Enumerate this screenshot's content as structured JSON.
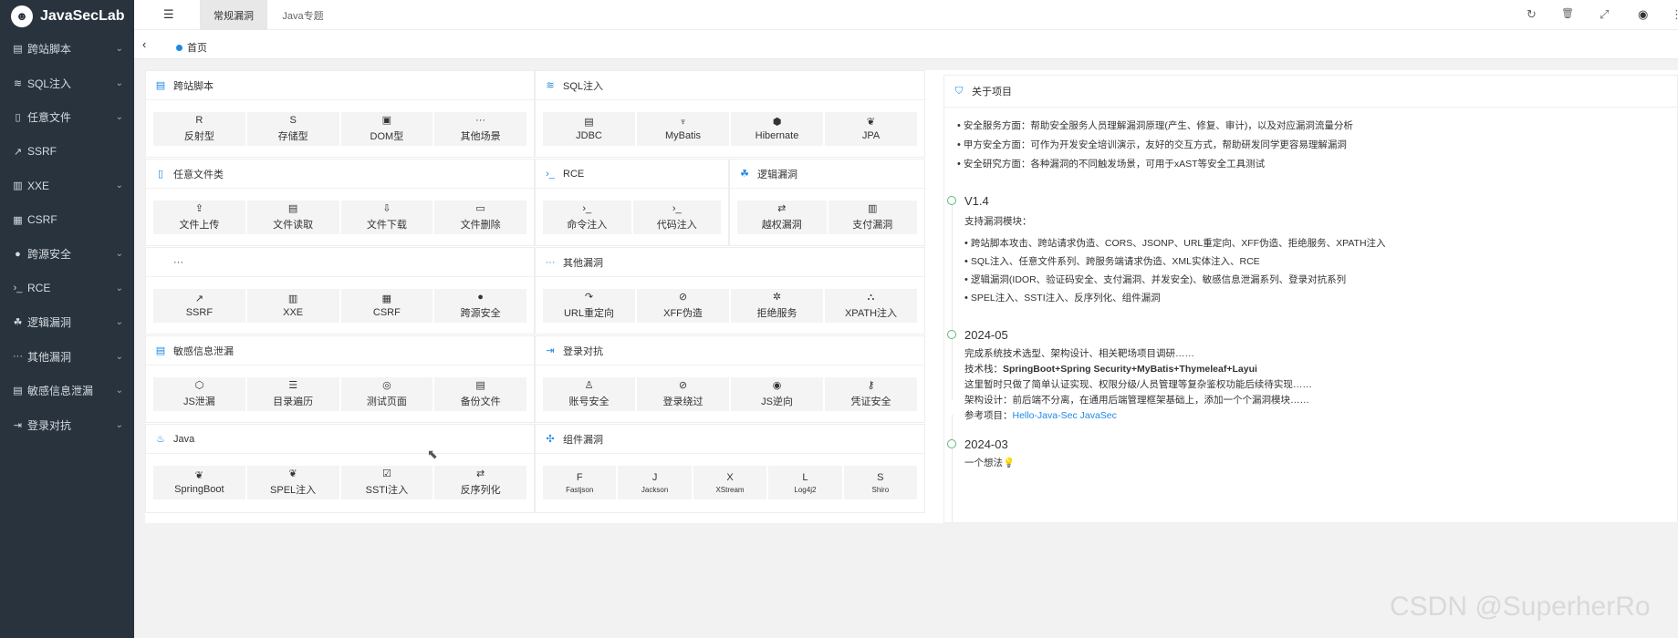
{
  "app": {
    "name": "JavaSecLab"
  },
  "sidebar": {
    "items": [
      {
        "label": "跨站脚本",
        "icon": "code-icon",
        "glyph": "▤",
        "chevron": true
      },
      {
        "label": "SQL注入",
        "icon": "sql-icon",
        "glyph": "≋",
        "chevron": true
      },
      {
        "label": "任意文件",
        "icon": "file-icon",
        "glyph": "▯",
        "chevron": true
      },
      {
        "label": "SSRF",
        "icon": "external-link-icon",
        "glyph": "↗",
        "chevron": false
      },
      {
        "label": "XXE",
        "icon": "document-icon",
        "glyph": "▥",
        "chevron": true
      },
      {
        "label": "CSRF",
        "icon": "forms-icon",
        "glyph": "▦",
        "chevron": false
      },
      {
        "label": "跨源安全",
        "icon": "security-icon",
        "glyph": "●",
        "chevron": true
      },
      {
        "label": "RCE",
        "icon": "terminal-icon",
        "glyph": "›_",
        "chevron": true
      },
      {
        "label": "逻辑漏洞",
        "icon": "logic-icon",
        "glyph": "☘",
        "chevron": true
      },
      {
        "label": "其他漏洞",
        "icon": "more-icon",
        "glyph": "···",
        "chevron": true
      },
      {
        "label": "敏感信息泄漏",
        "icon": "info-leak-icon",
        "glyph": "▤",
        "chevron": true
      },
      {
        "label": "登录对抗",
        "icon": "login-icon",
        "glyph": "⇥",
        "chevron": true
      }
    ]
  },
  "topbar": {
    "tabs": [
      "常规漏洞",
      "Java专题"
    ],
    "menu_glyph": "☰",
    "tools": [
      {
        "name": "refresh-icon",
        "glyph": "↻"
      },
      {
        "name": "trash-icon",
        "glyph": "🗑"
      },
      {
        "name": "fullscreen-icon",
        "glyph": "⤢"
      },
      {
        "name": "github-icon",
        "glyph": "◉"
      },
      {
        "name": "more-tools-icon",
        "glyph": "⋮"
      }
    ]
  },
  "breadcrumb": {
    "back_glyph": "‹",
    "home": "首页"
  },
  "cards": [
    {
      "title": "跨站脚本",
      "icon": "code-icon",
      "glyph": "▤",
      "tiles": [
        {
          "label": "反射型",
          "icon": "letter-r-icon",
          "glyph": "R"
        },
        {
          "label": "存储型",
          "icon": "letter-s-icon",
          "glyph": "S"
        },
        {
          "label": "DOM型",
          "icon": "image-icon",
          "glyph": "▣"
        },
        {
          "label": "其他场景",
          "icon": "ellipsis-icon",
          "glyph": "···"
        }
      ]
    },
    {
      "title": "SQL注入",
      "icon": "sql-icon",
      "glyph": "≋",
      "tiles": [
        {
          "label": "JDBC",
          "icon": "database-icon",
          "glyph": "▤"
        },
        {
          "label": "MyBatis",
          "icon": "bird-icon",
          "glyph": "♆"
        },
        {
          "label": "Hibernate",
          "icon": "hibernate-icon",
          "glyph": "⬢"
        },
        {
          "label": "JPA",
          "icon": "leaf-icon",
          "glyph": "❦"
        }
      ]
    },
    {
      "title": "任意文件类",
      "icon": "file-icon",
      "glyph": "▯",
      "tiles": [
        {
          "label": "文件上传",
          "icon": "file-upload-icon",
          "glyph": "⇪"
        },
        {
          "label": "文件读取",
          "icon": "file-read-icon",
          "glyph": "▤"
        },
        {
          "label": "文件下载",
          "icon": "file-download-icon",
          "glyph": "⇩"
        },
        {
          "label": "文件删除",
          "icon": "file-delete-icon",
          "glyph": "▭"
        }
      ]
    },
    {
      "title": "RCE",
      "icon": "terminal-icon",
      "glyph": "›_",
      "tiles": [
        {
          "label": "命令注入",
          "icon": "terminal-icon",
          "glyph": "›_"
        },
        {
          "label": "代码注入",
          "icon": "terminal-icon",
          "glyph": "›_"
        }
      ]
    },
    {
      "title": "逻辑漏洞",
      "icon": "logic-icon",
      "glyph": "☘",
      "tiles": [
        {
          "label": "越权漏洞",
          "icon": "swap-icon",
          "glyph": "⇄"
        },
        {
          "label": "支付漏洞",
          "icon": "payment-icon",
          "glyph": "▥"
        }
      ]
    },
    {
      "title": "···",
      "icon": "more-icon",
      "glyph": "",
      "tiles": [
        {
          "label": "SSRF",
          "icon": "external-link-icon",
          "glyph": "↗"
        },
        {
          "label": "XXE",
          "icon": "document-icon",
          "glyph": "▥"
        },
        {
          "label": "CSRF",
          "icon": "forms-icon",
          "glyph": "▦"
        },
        {
          "label": "跨源安全",
          "icon": "security-icon",
          "glyph": "●"
        }
      ]
    },
    {
      "title": "其他漏洞",
      "icon": "more-icon",
      "glyph": "···",
      "tiles": [
        {
          "label": "URL重定向",
          "icon": "redirect-icon",
          "glyph": "↷"
        },
        {
          "label": "XFF伪造",
          "icon": "compass-icon",
          "glyph": "⊘"
        },
        {
          "label": "拒绝服务",
          "icon": "gear-icon",
          "glyph": "✲"
        },
        {
          "label": "XPATH注入",
          "icon": "tree-icon",
          "glyph": "⛬"
        }
      ]
    },
    {
      "title": "敏感信息泄漏",
      "icon": "info-leak-icon",
      "glyph": "▤",
      "tiles": [
        {
          "label": "JS泄漏",
          "icon": "js-icon",
          "glyph": "⬡"
        },
        {
          "label": "目录遍历",
          "icon": "list-icon",
          "glyph": "☰"
        },
        {
          "label": "测试页面",
          "icon": "test-page-icon",
          "glyph": "◎"
        },
        {
          "label": "备份文件",
          "icon": "backup-icon",
          "glyph": "▤"
        }
      ]
    },
    {
      "title": "登录对抗",
      "icon": "login-icon",
      "glyph": "⇥",
      "tiles": [
        {
          "label": "账号安全",
          "icon": "user-icon",
          "glyph": "♙"
        },
        {
          "label": "登录绕过",
          "icon": "bypass-icon",
          "glyph": "⊘"
        },
        {
          "label": "JS逆向",
          "icon": "reverse-icon",
          "glyph": "◉"
        },
        {
          "label": "凭证安全",
          "icon": "key-icon",
          "glyph": "⚷"
        }
      ]
    },
    {
      "title": "Java",
      "icon": "java-icon",
      "glyph": "♨",
      "tiles": [
        {
          "label": "SpringBoot",
          "icon": "leaf-icon",
          "glyph": "❦"
        },
        {
          "label": "SPEL注入",
          "icon": "leaf-icon",
          "glyph": "❦"
        },
        {
          "label": "SSTI注入",
          "icon": "checkbox-icon",
          "glyph": "☑"
        },
        {
          "label": "反序列化",
          "icon": "json-icon",
          "glyph": "⇄"
        }
      ]
    },
    {
      "title": "组件漏洞",
      "icon": "puzzle-icon",
      "glyph": "✣",
      "tiles": [
        {
          "label": "Fastjson",
          "icon": "letter-f-icon",
          "glyph": "F"
        },
        {
          "label": "Jackson",
          "icon": "letter-j-icon",
          "glyph": "J"
        },
        {
          "label": "XStream",
          "icon": "letter-x-icon",
          "glyph": "X"
        },
        {
          "label": "Log4j2",
          "icon": "letter-l-icon",
          "glyph": "L"
        },
        {
          "label": "Shiro",
          "icon": "letter-s-icon",
          "glyph": "S"
        }
      ]
    }
  ],
  "about": {
    "title": "关于项目",
    "icon": "shield-icon",
    "glyph": "⛉",
    "points": [
      "安全服务方面：帮助安全服务人员理解漏洞原理(产生、修复、审计)，以及对应漏洞流量分析",
      "甲方安全方面：可作为开发安全培训演示，友好的交互方式，帮助研发同学更容易理解漏洞",
      "安全研究方面：各种漏洞的不同触发场景，可用于xAST等安全工具测试"
    ]
  },
  "timeline": {
    "v14": {
      "title": "V1.4",
      "intro": "支持漏洞模块：",
      "items": [
        "跨站脚本攻击、跨站请求伪造、CORS、JSONP、URL重定向、XFF伪造、拒绝服务、XPATH注入",
        "SQL注入、任意文件系列、跨服务端请求伪造、XML实体注入、RCE",
        "逻辑漏洞(IDOR、验证码安全、支付漏洞、并发安全)、敏感信息泄漏系列、登录对抗系列",
        "SPEL注入、SSTI注入、反序列化、组件漏洞"
      ]
    },
    "d202405": {
      "title": "2024-05",
      "line1": "完成系统技术选型、架构设计、相关靶场项目调研……",
      "stack_label": "技术栈：",
      "stack_value": "SpringBoot+Spring Security+MyBatis+Thymeleaf+Layui",
      "line3": "这里暂时只做了简单认证实现、权限分级/人员管理等复杂鉴权功能后续待实现……",
      "line4": "架构设计：前后端不分离，在通用后端管理框架基础上，添加一个个漏洞模块……",
      "ref_label": "参考项目：",
      "ref_links": "Hello-Java-Sec JavaSec"
    },
    "d202403": {
      "title": "2024-03",
      "text": "一个想法💡"
    }
  },
  "watermark": "CSDN @SuperherRo",
  "colors": {
    "sidebar": "#28333e",
    "accent": "#1e88e5",
    "timeline": "#5fb878"
  }
}
